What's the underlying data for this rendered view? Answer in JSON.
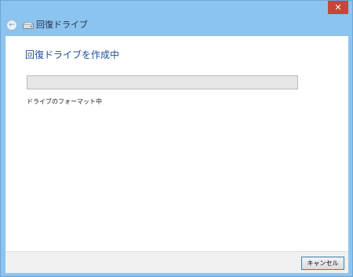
{
  "window": {
    "title": "回復ドライブ",
    "close_glyph": "✕"
  },
  "nav": {
    "back_glyph": "←",
    "icon": "drive-icon"
  },
  "main": {
    "heading": "回復ドライブを作成中",
    "progress_fraction": 0,
    "status": "ドライブのフォーマット中"
  },
  "footer": {
    "cancel_label": "キャンセル"
  },
  "colors": {
    "frame": "#8cc4ef",
    "close": "#c7453c",
    "heading": "#1d4f99",
    "progress_track": "#e6e6e6",
    "progress_fill": "#06b025"
  }
}
